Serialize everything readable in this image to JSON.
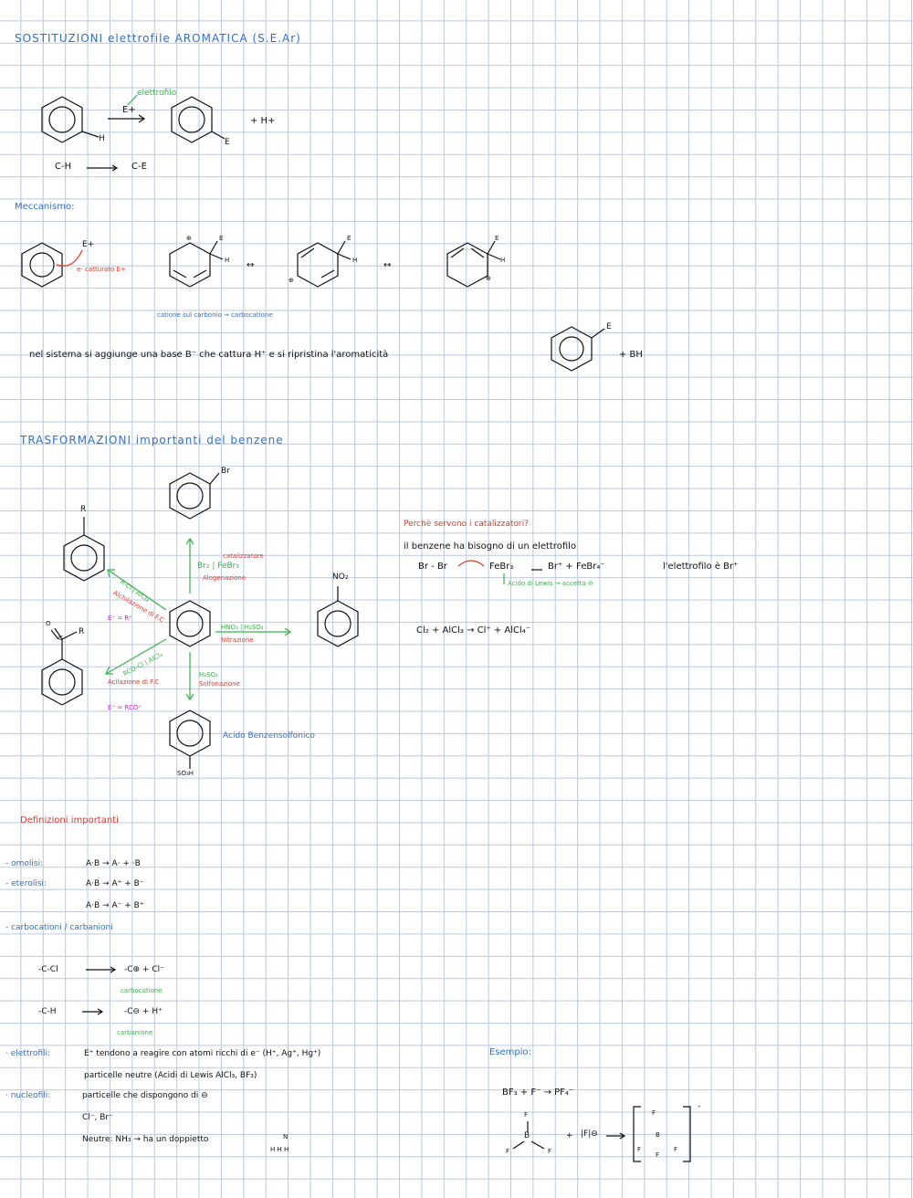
{
  "section1": {
    "title": "SOSTITUZIONI elettrofile AROMATICA (S.E.Ar)",
    "reagent": "E+",
    "reagent_note": "elettrofilo",
    "sub_H": "H",
    "sub_E": "E",
    "byproduct": "+ H+",
    "bond_from": "C-H",
    "bond_to": "C-E"
  },
  "mechanism": {
    "title": "Meccanismo:",
    "electrophile": "E+",
    "capture_note": "e- catturato E+",
    "sub_E": "E",
    "sub_H": "H",
    "charge": "⊕",
    "resonance": "↔",
    "note": "catione sul carbonio → carbocatione",
    "restore_text": "nel sistema si aggiunge una base B⁻ che cattura H⁺ e si ripristina l'aromaticità",
    "product_E": "E",
    "product_plus": "+ BH"
  },
  "section2": {
    "title": "TRASFORMAZIONI importanti del benzene",
    "top_sub": "Br",
    "halog_reagent": "Br₂ | FeBr₃",
    "halog_cat": "catalizzatore",
    "halog_label": "Alogenazione",
    "alkyl_reagent": "R-Cl | AlCl₃",
    "alkyl_label": "Alchilazione di F.C",
    "alkyl_E": "E⁺ = R⁺",
    "left_top_sub": "R",
    "nitr_reagent": "HNO₃ | H₂SO₄",
    "nitr_label": "Nitrazione",
    "right_sub": "NO₂",
    "acyl_reagent": "RCO-Cl | AlCl₃",
    "acyl_label": "Acilazione di F.C",
    "acyl_E": "E⁺ = RCO⁺",
    "left_bottom_O": "O",
    "left_bottom_C": "C",
    "left_bottom_R": "R",
    "sulf_reagent": "H₂SO₄",
    "sulf_label": "Solfonazione",
    "bottom_sub": "SO₃H",
    "bottom_name": "Acido Benzensolfonico"
  },
  "catalysts": {
    "question": "Perchè servono i catalizzatori?",
    "line1": "il benzene ha bisogno di un elettrofilo",
    "eq1_left": "Br - Br",
    "eq1_cat": "FeBr₃",
    "eq1_arrow": "→",
    "eq1_right": "Br⁺ + FeBr₄⁻",
    "eq1_note": "l'elettrofilo è Br⁺",
    "lewis_note": "Acido di Lewis → accetta ⊖",
    "eq2": "Cl₂ + AlCl₃ → Cl⁺ + AlCl₄⁻"
  },
  "definitions": {
    "title": "Definizioni importanti",
    "omolisi_label": "- omolisi:",
    "omolisi_eq": "A·B → A· + ·B",
    "eterolisi_label": "- eterolisi:",
    "eterolisi_eq1": "A·B → A⁺ + B⁻",
    "eterolisi_eq2": "A·B → A⁻ + B⁺",
    "carbo_label": "- carbocationi / carbanioni",
    "carbo_eq1_left": "-C-Cl",
    "carbo_eq1_right": "-C⊕ + Cl⁻",
    "carbo_eq1_note": "carbocatione",
    "carbo_eq2_left": "-C-H",
    "carbo_eq2_right": "-C⊖ + H⁺",
    "carbo_eq2_note": "carbanione",
    "elettrofili_label": "· elettrofili:",
    "elettrofili_text": "E⁺ tendono a reagire con atomi ricchi di e⁻ (H⁺, Ag⁺, Hg⁺)",
    "elettrofili_text2": "particelle neutre (Acidi di Lewis AlCl₃, BF₃)",
    "nucleofili_label": "· nucleofili:",
    "nucleofili_text": "particelle che dispongono di ⊖",
    "nucleofili_text2": "Cl⁻, Br⁻",
    "nucleofili_text3": "Neutre: NH₃ → ha un doppietto",
    "nh3_N": "N",
    "nh3_H": "H H H"
  },
  "example": {
    "title": "Esempio:",
    "eq": "BF₃ + F⁻ → PF₄⁻",
    "F": "F",
    "B": "B",
    "plus": "+",
    "fluoride": "|F|⊖",
    "arrow": "→",
    "charge": "-"
  }
}
